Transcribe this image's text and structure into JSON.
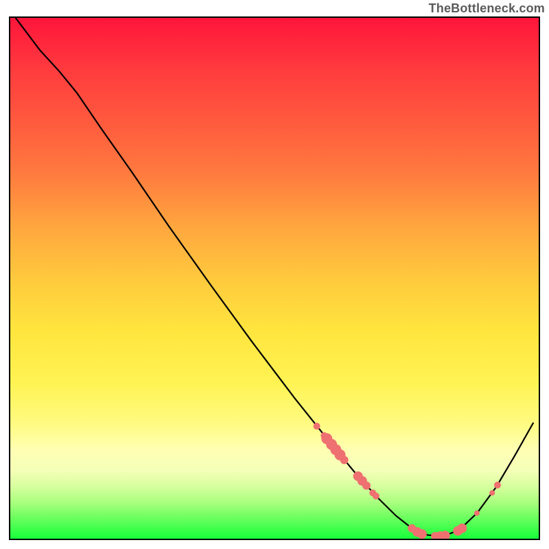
{
  "attribution": "TheBottleneck.com",
  "chart_data": {
    "type": "line",
    "title": "",
    "xlabel": "",
    "ylabel": "",
    "xlim": [
      0,
      100
    ],
    "ylim": [
      0,
      100
    ],
    "curve": [
      {
        "x": 1.0,
        "y": 100.0
      },
      {
        "x": 5.6,
        "y": 93.8
      },
      {
        "x": 9.3,
        "y": 89.7
      },
      {
        "x": 12.6,
        "y": 85.6
      },
      {
        "x": 17.3,
        "y": 78.6
      },
      {
        "x": 23.0,
        "y": 70.4
      },
      {
        "x": 30.0,
        "y": 60.0
      },
      {
        "x": 38.0,
        "y": 48.6
      },
      {
        "x": 45.6,
        "y": 38.0
      },
      {
        "x": 53.8,
        "y": 27.0
      },
      {
        "x": 60.5,
        "y": 18.5
      },
      {
        "x": 65.3,
        "y": 12.6
      },
      {
        "x": 69.4,
        "y": 8.0
      },
      {
        "x": 73.0,
        "y": 4.4
      },
      {
        "x": 76.0,
        "y": 2.0
      },
      {
        "x": 79.0,
        "y": 0.7
      },
      {
        "x": 82.0,
        "y": 0.5
      },
      {
        "x": 85.0,
        "y": 1.7
      },
      {
        "x": 88.4,
        "y": 5.0
      },
      {
        "x": 92.0,
        "y": 10.0
      },
      {
        "x": 95.5,
        "y": 16.0
      },
      {
        "x": 99.0,
        "y": 22.3
      }
    ],
    "markers": [
      {
        "x": 58.0,
        "y": 21.6,
        "r": 5
      },
      {
        "x": 59.4,
        "y": 19.8,
        "r": 5
      },
      {
        "x": 59.9,
        "y": 19.2,
        "r": 8
      },
      {
        "x": 60.8,
        "y": 18.1,
        "r": 8
      },
      {
        "x": 61.6,
        "y": 17.1,
        "r": 8
      },
      {
        "x": 62.4,
        "y": 16.1,
        "r": 8
      },
      {
        "x": 63.2,
        "y": 15.1,
        "r": 6
      },
      {
        "x": 65.8,
        "y": 12.0,
        "r": 7
      },
      {
        "x": 66.6,
        "y": 11.1,
        "r": 7
      },
      {
        "x": 67.4,
        "y": 10.2,
        "r": 6
      },
      {
        "x": 68.6,
        "y": 8.8,
        "r": 5
      },
      {
        "x": 69.2,
        "y": 8.2,
        "r": 5
      },
      {
        "x": 76.0,
        "y": 2.0,
        "r": 6
      },
      {
        "x": 77.0,
        "y": 1.3,
        "r": 7
      },
      {
        "x": 77.9,
        "y": 0.9,
        "r": 7
      },
      {
        "x": 80.4,
        "y": 0.5,
        "r": 6
      },
      {
        "x": 81.4,
        "y": 0.5,
        "r": 7
      },
      {
        "x": 82.3,
        "y": 0.6,
        "r": 7
      },
      {
        "x": 84.7,
        "y": 1.5,
        "r": 7
      },
      {
        "x": 85.5,
        "y": 2.0,
        "r": 7
      },
      {
        "x": 88.3,
        "y": 4.9,
        "r": 4
      },
      {
        "x": 91.2,
        "y": 8.8,
        "r": 4
      },
      {
        "x": 92.2,
        "y": 10.3,
        "r": 5
      }
    ],
    "colors": {
      "curve": "#000000",
      "marker": "#ef7070",
      "gradient_top": "#ff153b",
      "gradient_bottom": "#17ff3b"
    }
  }
}
